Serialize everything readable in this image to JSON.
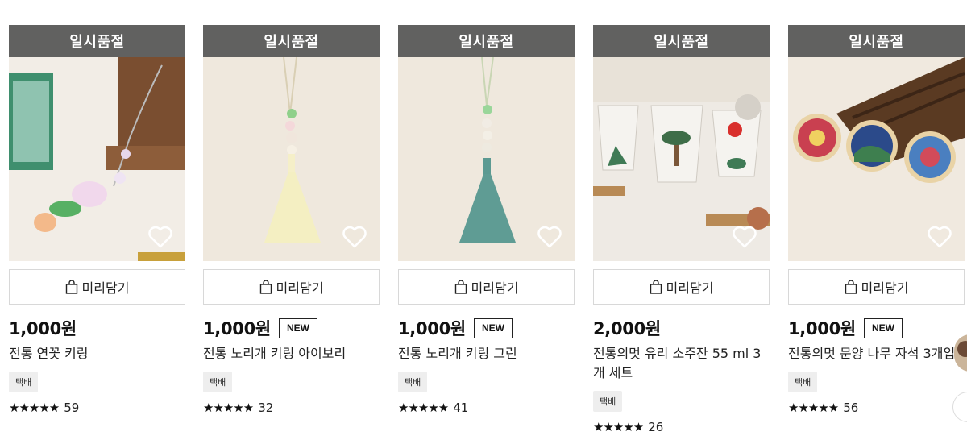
{
  "products": [
    {
      "soldout": "일시품절",
      "prebuy": "미리담기",
      "price": "1,000원",
      "badge": "",
      "title": "전통 연꽃 키링",
      "shipping": "택배",
      "stars": "★★★★★",
      "reviews": "59"
    },
    {
      "soldout": "일시품절",
      "prebuy": "미리담기",
      "price": "1,000원",
      "badge": "NEW",
      "title": "전통 노리개 키링 아이보리",
      "shipping": "택배",
      "stars": "★★★★★",
      "reviews": "32"
    },
    {
      "soldout": "일시품절",
      "prebuy": "미리담기",
      "price": "1,000원",
      "badge": "NEW",
      "title": "전통 노리개 키링 그린",
      "shipping": "택배",
      "stars": "★★★★★",
      "reviews": "41"
    },
    {
      "soldout": "일시품절",
      "prebuy": "미리담기",
      "price": "2,000원",
      "badge": "",
      "title": "전통의멋 유리 소주잔 55 ml 3개 세트",
      "shipping": "택배",
      "stars": "★★★★★",
      "reviews": "26"
    },
    {
      "soldout": "일시품절",
      "prebuy": "미리담기",
      "price": "1,000원",
      "badge": "NEW",
      "title": "전통의멋 문양 나무 자석 3개입",
      "shipping": "택배",
      "stars": "★★★★★",
      "reviews": "56"
    }
  ],
  "icons": {
    "heart": "heart-icon",
    "bag": "shopping-bag-icon"
  },
  "colors": {
    "soldout_bar": "#555555",
    "text": "#111111"
  }
}
